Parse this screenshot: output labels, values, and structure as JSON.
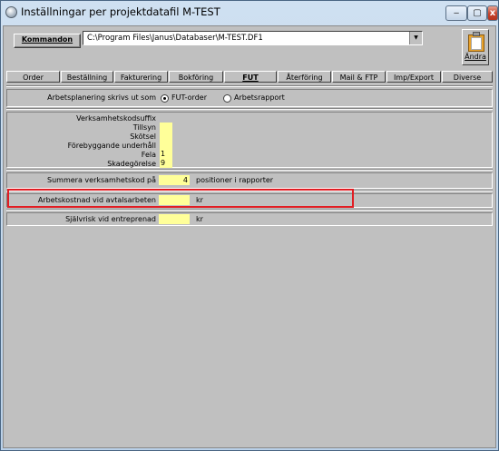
{
  "window": {
    "title": "Inställningar per projektdatafil  M-TEST",
    "minimize_label": "‒",
    "maximize_label": "▢",
    "close_label": "x"
  },
  "toolbar": {
    "command_label": "Kommandon",
    "path_value": "C:\\Program Files\\Janus\\Databaser\\M-TEST.DF1",
    "dropdown_arrow": "▼",
    "edit_label": "Ändra"
  },
  "tabs": [
    {
      "label": "Order"
    },
    {
      "label": "Beställning"
    },
    {
      "label": "Fakturering"
    },
    {
      "label": "Bokföring"
    },
    {
      "label": "FUT",
      "active": true
    },
    {
      "label": "Återföring"
    },
    {
      "label": "Mail & FTP"
    },
    {
      "label": "Imp/Export"
    },
    {
      "label": "Diverse"
    }
  ],
  "planning": {
    "label": "Arbetsplanering skrivs ut som",
    "options": [
      {
        "label": "FUT-order",
        "selected": true
      },
      {
        "label": "Arbetsrapport",
        "selected": false
      }
    ]
  },
  "suffix": {
    "heading": "Verksamhetskodsuffix",
    "rows": [
      {
        "label": "Tillsyn",
        "value": ""
      },
      {
        "label": "Skötsel",
        "value": ""
      },
      {
        "label": "Förebyggande underhåll",
        "value": ""
      },
      {
        "label": "Fela",
        "value": "1"
      },
      {
        "label": "Skadegörelse",
        "value": "9"
      }
    ]
  },
  "summary": {
    "label": "Summera verksamhetskod på",
    "value": "4",
    "unit": "positioner i rapporter"
  },
  "labor_cost": {
    "label": "Arbetskostnad vid avtalsarbeten",
    "value": "",
    "unit": "kr"
  },
  "deductible": {
    "label": "Självrisk vid entreprenad",
    "value": "",
    "unit": "kr"
  },
  "colors": {
    "field_bg": "#ffff99",
    "highlight_frame": "#e11d23",
    "face": "#c0c0c0"
  }
}
